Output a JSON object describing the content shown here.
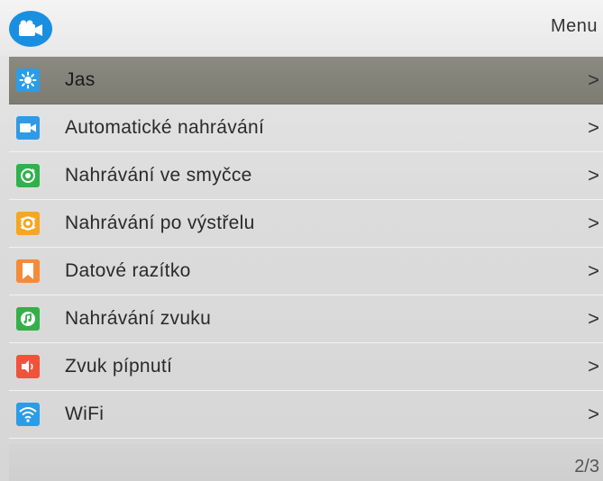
{
  "header": {
    "title": "Menu",
    "icon": "video-camera-icon",
    "icon_color": "#1a8fe0"
  },
  "menu": {
    "items": [
      {
        "label": "Jas",
        "icon": "brightness-icon",
        "icon_color": "#2b9de8",
        "selected": true
      },
      {
        "label": "Automatické nahrávání",
        "icon": "video-camera-icon",
        "icon_color": "#2f9be6",
        "selected": false
      },
      {
        "label": "Nahrávání ve smyčce",
        "icon": "loop-record-icon",
        "icon_color": "#2fb24c",
        "selected": false
      },
      {
        "label": "Nahrávání po výstřelu",
        "icon": "shot-record-icon",
        "icon_color": "#f5a623",
        "selected": false
      },
      {
        "label": "Datové razítko",
        "icon": "date-stamp-icon",
        "icon_color": "#f58a3a",
        "selected": false
      },
      {
        "label": "Nahrávání zvuku",
        "icon": "audio-record-icon",
        "icon_color": "#34b048",
        "selected": false
      },
      {
        "label": "Zvuk pípnutí",
        "icon": "beep-sound-icon",
        "icon_color": "#f0533a",
        "selected": false
      },
      {
        "label": "WiFi",
        "icon": "wifi-icon",
        "icon_color": "#2b9de8",
        "selected": false
      }
    ],
    "chevron": ">"
  },
  "footer": {
    "page": "2/3"
  }
}
